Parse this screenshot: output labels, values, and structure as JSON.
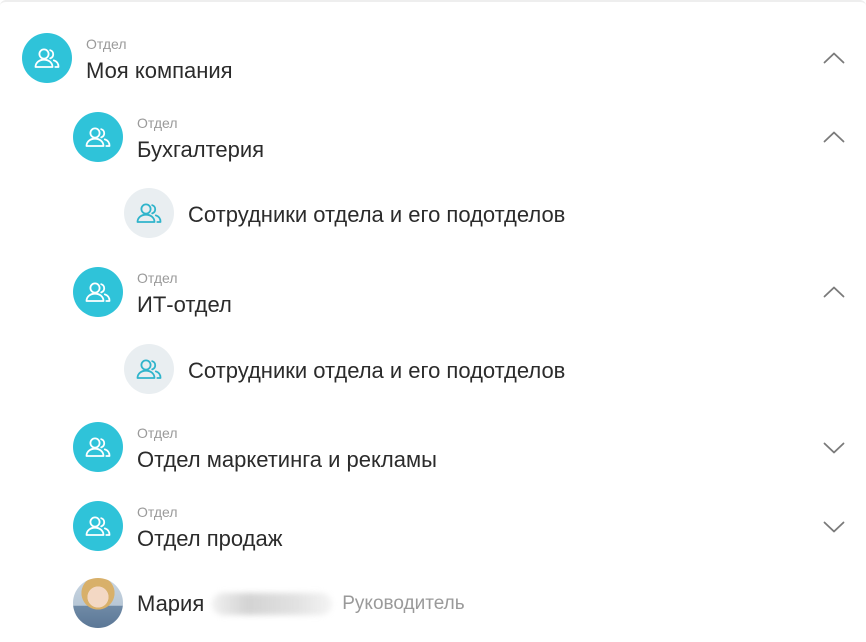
{
  "tree": {
    "root": {
      "caption": "Отдел",
      "name": "Моя компания"
    },
    "departments": [
      {
        "caption": "Отдел",
        "name": "Бухгалтерия",
        "members_label": "Сотрудники отдела и его подотделов"
      },
      {
        "caption": "Отдел",
        "name": "ИТ-отдел",
        "members_label": "Сотрудники отдела и его подотделов"
      },
      {
        "caption": "Отдел",
        "name": "Отдел маркетинга и рекламы"
      },
      {
        "caption": "Отдел",
        "name": "Отдел продаж"
      }
    ],
    "head": {
      "first_name": "Мария",
      "role": "Руководитель"
    }
  },
  "icons": {
    "department": "users-icon",
    "members": "users-icon",
    "expanded": "chevron-up-icon",
    "collapsed": "chevron-down-icon"
  },
  "colors": {
    "accent": "#2fc3d9",
    "members_bg": "#e9eef1",
    "caption": "#9a9a9a",
    "text": "#2b2b2b"
  }
}
